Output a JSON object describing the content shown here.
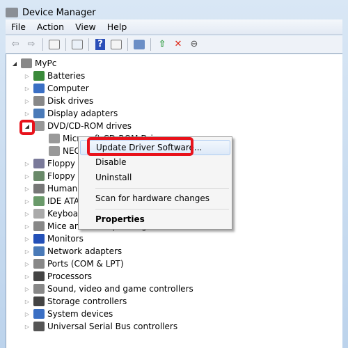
{
  "window": {
    "title": "Device Manager"
  },
  "menu": [
    "File",
    "Action",
    "View",
    "Help"
  ],
  "toolbar": [
    {
      "icon": "back-arrow-icon"
    },
    {
      "icon": "forward-arrow-icon"
    },
    {
      "icon": "show-hide-console-tree-icon"
    },
    {
      "icon": "properties-icon"
    },
    {
      "icon": "help-icon"
    },
    {
      "icon": "show-action-pane-icon"
    },
    {
      "icon": "scan-hardware-icon"
    },
    {
      "icon": "update-driver-icon"
    },
    {
      "icon": "uninstall-icon"
    },
    {
      "icon": "disable-icon"
    }
  ],
  "tree": {
    "root": "MyPc",
    "items": [
      "Batteries",
      "Computer",
      "Disk drives",
      "Display adapters",
      "DVD/CD-ROM drives",
      "Microsoft CD-ROM Drive",
      "NECVMWar VMware IDE CDR10",
      "Floppy disk controllers",
      "Floppy disk drives",
      "Human Interface Devices",
      "IDE ATA/ATAPI controllers",
      "Keyboards",
      "Mice and other pointing devices",
      "Monitors",
      "Network adapters",
      "Ports (COM & LPT)",
      "Processors",
      "Sound, video and game controllers",
      "Storage controllers",
      "System devices",
      "Universal Serial Bus controllers"
    ]
  },
  "context_menu": {
    "items": [
      "Update Driver Software...",
      "Disable",
      "Uninstall",
      "Scan for hardware changes",
      "Properties"
    ]
  },
  "colors": {
    "highlight": "#e8121b",
    "accent": "#3a6fc4"
  }
}
